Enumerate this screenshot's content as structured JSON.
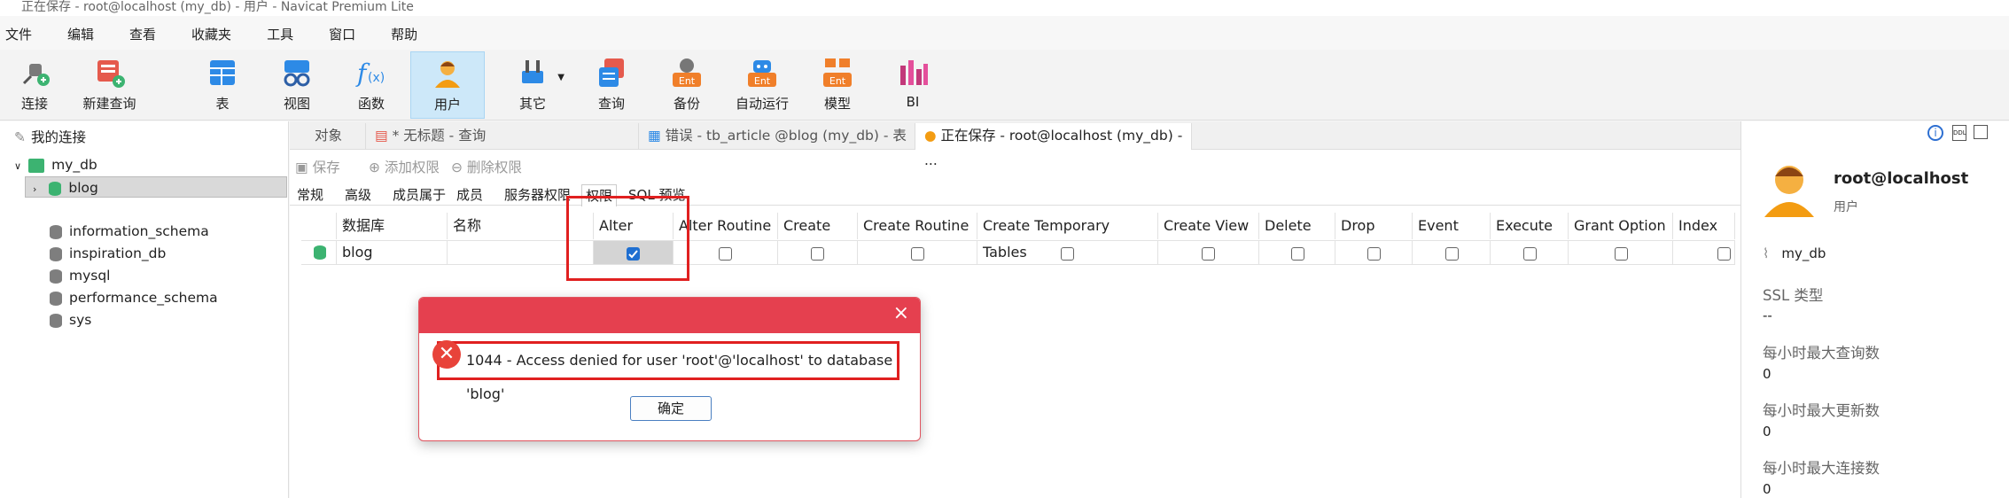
{
  "window": {
    "title": "正在保存 - root@localhost (my_db) - 用户 - Navicat Premium Lite"
  },
  "menu": [
    "文件",
    "编辑",
    "查看",
    "收藏夹",
    "工具",
    "窗口",
    "帮助"
  ],
  "toolbar": [
    {
      "label": "连接",
      "icon": "plug-icon"
    },
    {
      "label": "新建查询",
      "icon": "new-query-icon"
    },
    {
      "label": "表",
      "icon": "table-icon"
    },
    {
      "label": "视图",
      "icon": "view-icon"
    },
    {
      "label": "函数",
      "icon": "function-icon"
    },
    {
      "label": "用户",
      "icon": "user-icon"
    },
    {
      "label": "其它",
      "icon": "tools-icon"
    },
    {
      "label": "查询",
      "icon": "query-icon"
    },
    {
      "label": "备份",
      "icon": "backup-icon"
    },
    {
      "label": "自动运行",
      "icon": "robot-icon"
    },
    {
      "label": "模型",
      "icon": "model-icon"
    },
    {
      "label": "BI",
      "icon": "bi-chart-icon"
    }
  ],
  "ent_badge": "Ent",
  "sidebar": {
    "header": "我的连接",
    "connection": "my_db",
    "selected_db": "blog",
    "databases": [
      "information_schema",
      "inspiration_db",
      "mysql",
      "performance_schema",
      "sys"
    ]
  },
  "tabs": [
    "对象",
    "* 无标题 - 查询",
    "错误 - tb_article @blog (my_db) - 表",
    "正在保存 - root@localhost (my_db) - ..."
  ],
  "subtoolbar": {
    "save": "保存",
    "add": "添加权限",
    "remove": "删除权限"
  },
  "subtabs": [
    "常规",
    "高级",
    "成员属于",
    "成员",
    "服务器权限",
    "权限",
    "SQL 预览"
  ],
  "grid": {
    "columns": [
      "数据库",
      "名称",
      "Alter",
      "Alter Routine",
      "Create",
      "Create Routine",
      "Create Temporary Tables",
      "Create View",
      "Delete",
      "Drop",
      "Event",
      "Execute",
      "Grant Option",
      "Index"
    ],
    "row": {
      "database": "blog",
      "name": "",
      "checked": [
        true,
        false,
        false,
        false,
        false,
        false,
        false,
        false,
        false,
        false,
        false,
        false
      ]
    }
  },
  "right_panel": {
    "user": "root@localhost",
    "type": "用户",
    "connection": "my_db",
    "fields": [
      {
        "label": "SSL 类型",
        "value": "--"
      },
      {
        "label": "每小时最大查询数",
        "value": "0"
      },
      {
        "label": "每小时最大更新数",
        "value": "0"
      },
      {
        "label": "每小时最大连接数",
        "value": "0"
      }
    ]
  },
  "dialog": {
    "message": "1044 - Access denied for user 'root'@'localhost' to database 'blog'",
    "ok": "确定",
    "close": "×"
  },
  "colors": {
    "accent": "#1f6fd1",
    "error": "#e5404f",
    "highlight": "#e02020"
  }
}
